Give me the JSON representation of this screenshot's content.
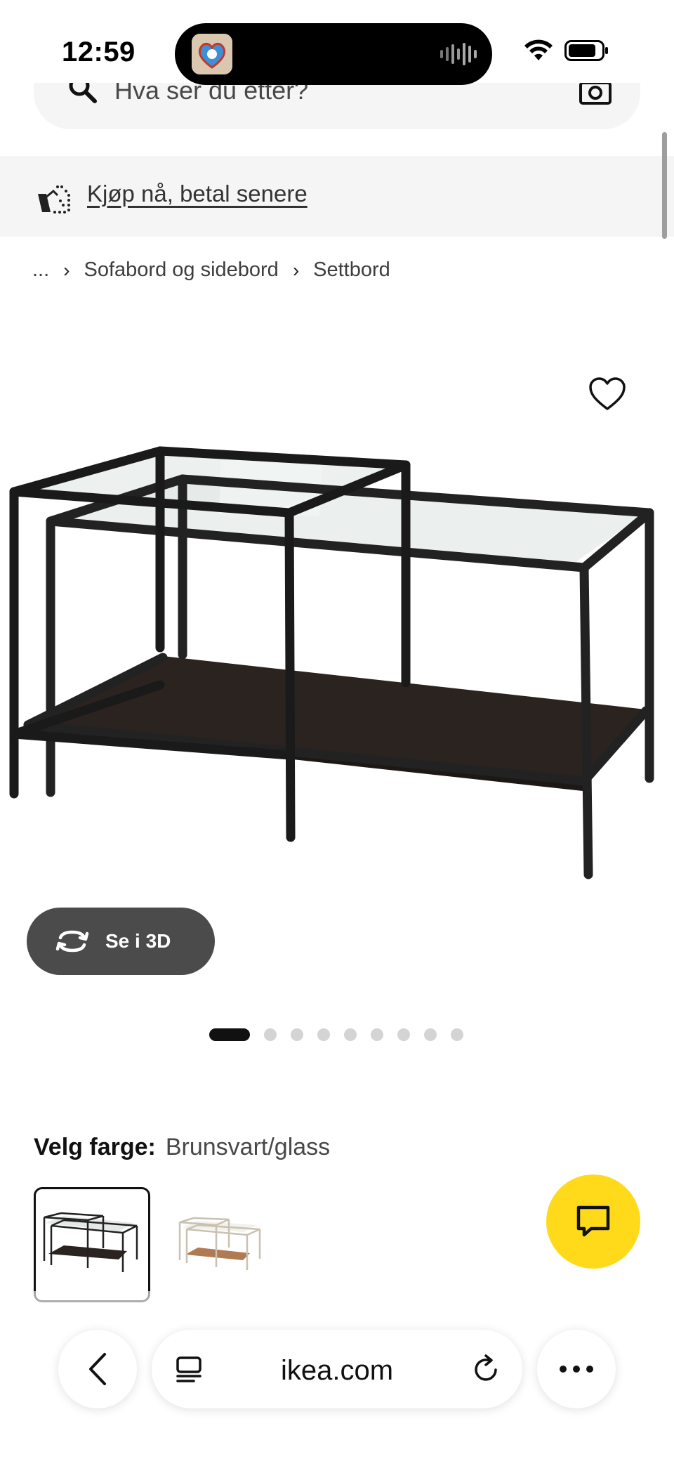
{
  "status_bar": {
    "time": "12:59"
  },
  "search": {
    "placeholder": "Hva ser du etter?"
  },
  "banner": {
    "label": "Kjøp nå, betal senere"
  },
  "breadcrumb": {
    "ellipsis": "...",
    "items": [
      "Sofabord og sidebord",
      "Settbord"
    ]
  },
  "media": {
    "view_3d_label": "Se i 3D",
    "image_count": 9,
    "active_index": 0
  },
  "color_picker": {
    "label": "Velg farge:",
    "selected": "Brunsvart/glass"
  },
  "browser": {
    "url": "ikea.com"
  },
  "colors": {
    "accent_yellow": "#ffda1a",
    "button_dark": "#4b4b4b",
    "banner_bg": "#f5f5f5"
  },
  "icons": [
    "search-icon",
    "camera-icon",
    "pay-later-icon",
    "heart-icon",
    "rotate-3d-icon",
    "chat-icon",
    "back-icon",
    "tabs-icon",
    "reload-icon",
    "more-icon"
  ]
}
